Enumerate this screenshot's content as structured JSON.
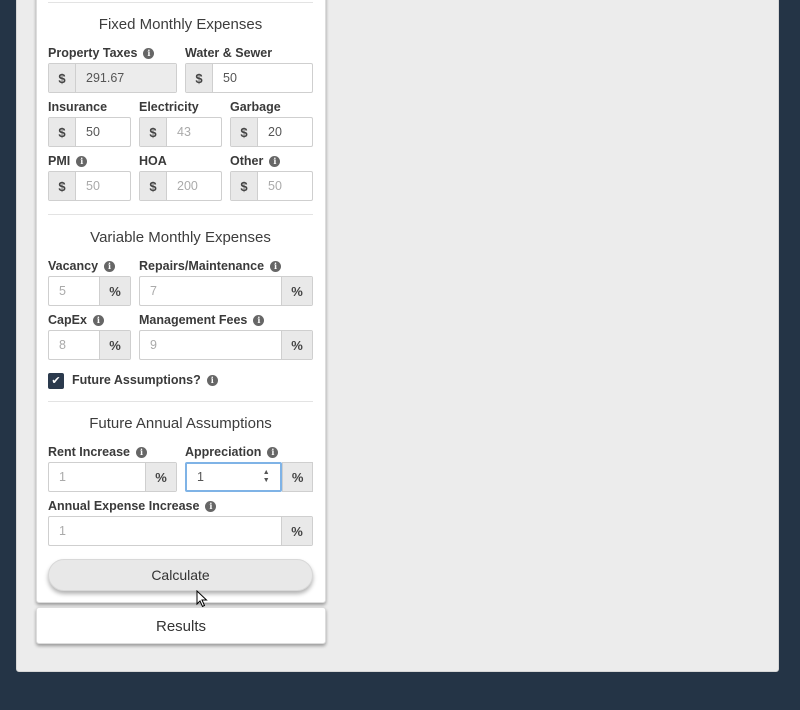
{
  "fixed": {
    "title": "Fixed Monthly Expenses",
    "property_taxes": {
      "label": "Property Taxes",
      "value": "291.67"
    },
    "water_sewer": {
      "label": "Water & Sewer",
      "value": "50"
    },
    "insurance": {
      "label": "Insurance",
      "value": "50"
    },
    "electricity": {
      "label": "Electricity",
      "placeholder": "43"
    },
    "garbage": {
      "label": "Garbage",
      "value": "20"
    },
    "pmi": {
      "label": "PMI",
      "placeholder": "50"
    },
    "hoa": {
      "label": "HOA",
      "placeholder": "200"
    },
    "other": {
      "label": "Other",
      "placeholder": "50"
    }
  },
  "variable": {
    "title": "Variable Monthly Expenses",
    "vacancy": {
      "label": "Vacancy",
      "placeholder": "5"
    },
    "repairs": {
      "label": "Repairs/Maintenance",
      "placeholder": "7"
    },
    "capex": {
      "label": "CapEx",
      "placeholder": "8"
    },
    "management": {
      "label": "Management Fees",
      "placeholder": "9"
    }
  },
  "future_toggle": {
    "label": "Future Assumptions?",
    "checked": true
  },
  "future": {
    "title": "Future Annual Assumptions",
    "rent_increase": {
      "label": "Rent Increase",
      "placeholder": "1"
    },
    "appreciation": {
      "label": "Appreciation",
      "value": "1"
    },
    "expense_increase": {
      "label": "Annual Expense Increase",
      "placeholder": "1"
    }
  },
  "symbols": {
    "dollar": "$",
    "percent": "%",
    "info": "i",
    "check": "✔",
    "spin_up": "▲",
    "spin_down": "▼"
  },
  "buttons": {
    "calculate": "Calculate"
  },
  "results": {
    "label": "Results"
  },
  "colors": {
    "page_bg": "#243446",
    "focus_border": "#7fb3e6",
    "checkbox": "#2b3a4d"
  }
}
